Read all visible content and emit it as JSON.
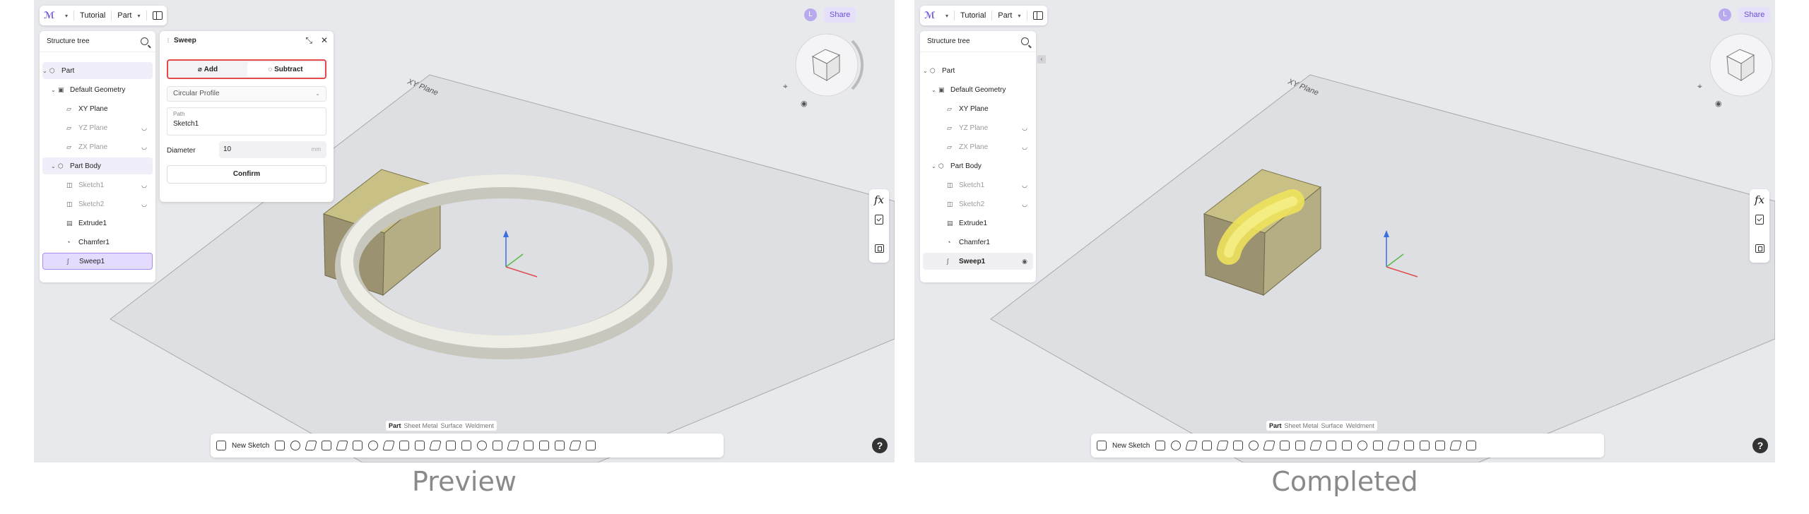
{
  "app": {
    "project": "Tutorial",
    "mode": "Part",
    "user_initial": "L",
    "share_label": "Share"
  },
  "tree": {
    "title": "Structure tree",
    "items": [
      {
        "label": "Part"
      },
      {
        "label": "Default Geometry"
      },
      {
        "label": "XY Plane"
      },
      {
        "label": "YZ Plane"
      },
      {
        "label": "ZX Plane"
      },
      {
        "label": "Part Body"
      },
      {
        "label": "Sketch1"
      },
      {
        "label": "Sketch2"
      },
      {
        "label": "Extrude1"
      },
      {
        "label": "Chamfer1"
      },
      {
        "label": "Sweep1"
      }
    ]
  },
  "sweep": {
    "title": "Sweep",
    "add_label": "Add",
    "subtract_label": "Subtract",
    "profile_value": "Circular Profile",
    "path_label": "Path",
    "path_value": "Sketch1",
    "diameter_label": "Diameter",
    "diameter_value": "10",
    "diameter_unit": "mm",
    "confirm_label": "Confirm"
  },
  "viewport": {
    "plane_label": "XY Plane",
    "fx_label": "fx"
  },
  "bottom": {
    "tabs": [
      "Part",
      "Sheet Metal",
      "Surface",
      "Weldment"
    ],
    "new_sketch_label": "New Sketch"
  },
  "help_label": "?",
  "captions": {
    "left": "Preview",
    "right": "Completed"
  },
  "colors": {
    "accent": "#6a4fd8",
    "highlight_border": "#e34b4b",
    "selection": "#e5dbff",
    "part_yellow": "#eee25c"
  }
}
